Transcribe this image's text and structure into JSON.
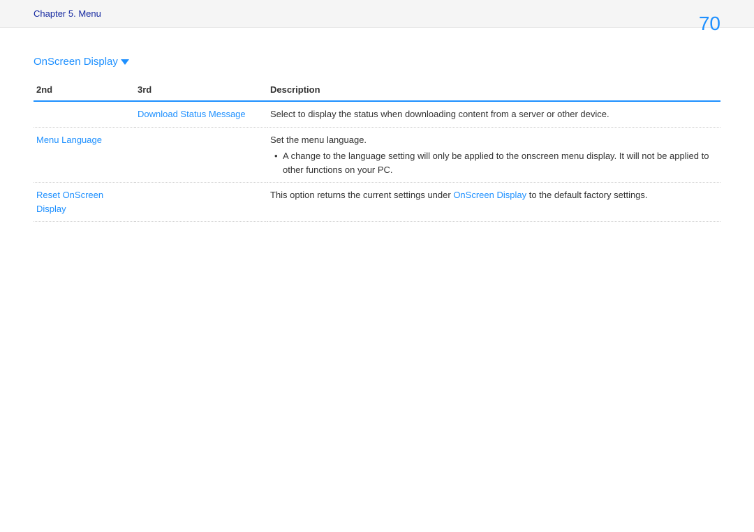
{
  "header": {
    "chapter": "Chapter 5. Menu",
    "page_number": "70"
  },
  "section": {
    "title": "OnScreen Display"
  },
  "table": {
    "headers": {
      "col1": "2nd",
      "col2": "3rd",
      "col3": "Description"
    },
    "rows": [
      {
        "second": "",
        "third": "Download Status Message",
        "description": "Select to display the status when downloading content from a server or other device."
      },
      {
        "second": "Menu Language",
        "third": "",
        "desc_main": "Set the menu language.",
        "desc_bullet": "A change to the language setting will only be applied to the onscreen menu display. It will not be applied to other functions on your PC."
      },
      {
        "second": "Reset OnScreen Display",
        "third": "",
        "desc_prefix": "This option returns the current settings under ",
        "desc_link": "OnScreen Display",
        "desc_suffix": " to the default factory settings."
      }
    ]
  }
}
